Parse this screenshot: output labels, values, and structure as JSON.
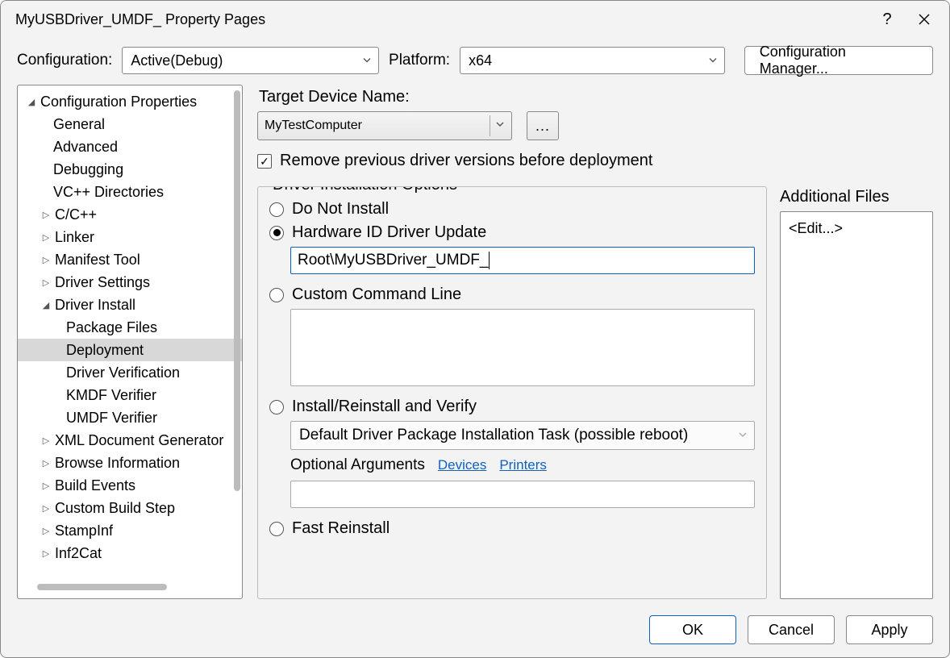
{
  "window": {
    "title": "MyUSBDriver_UMDF_ Property Pages"
  },
  "top": {
    "configuration_label": "Configuration:",
    "configuration_value": "Active(Debug)",
    "platform_label": "Platform:",
    "platform_value": "x64",
    "config_manager_label": "Configuration Manager..."
  },
  "tree": {
    "root": "Configuration Properties",
    "items": [
      {
        "label": "General",
        "level": 1
      },
      {
        "label": "Advanced",
        "level": 1
      },
      {
        "label": "Debugging",
        "level": 1
      },
      {
        "label": "VC++ Directories",
        "level": 1
      },
      {
        "label": "C/C++",
        "level": 1,
        "expander": "▷"
      },
      {
        "label": "Linker",
        "level": 1,
        "expander": "▷"
      },
      {
        "label": "Manifest Tool",
        "level": 1,
        "expander": "▷"
      },
      {
        "label": "Driver Settings",
        "level": 1,
        "expander": "▷"
      },
      {
        "label": "Driver Install",
        "level": 1,
        "expander": "◢"
      },
      {
        "label": "Package Files",
        "level": 2
      },
      {
        "label": "Deployment",
        "level": 2,
        "selected": true
      },
      {
        "label": "Driver Verification",
        "level": 2
      },
      {
        "label": "KMDF Verifier",
        "level": 2
      },
      {
        "label": "UMDF Verifier",
        "level": 2
      },
      {
        "label": "XML Document Generator",
        "level": 1,
        "expander": "▷"
      },
      {
        "label": "Browse Information",
        "level": 1,
        "expander": "▷"
      },
      {
        "label": "Build Events",
        "level": 1,
        "expander": "▷"
      },
      {
        "label": "Custom Build Step",
        "level": 1,
        "expander": "▷"
      },
      {
        "label": "StampInf",
        "level": 1,
        "expander": "▷"
      },
      {
        "label": "Inf2Cat",
        "level": 1,
        "expander": "▷"
      }
    ]
  },
  "main": {
    "target_device_label": "Target Device Name:",
    "target_device_value": "MyTestComputer",
    "ellipsis": "...",
    "remove_prev_label": "Remove previous driver versions before deployment",
    "remove_prev_checked": true,
    "fieldset_legend": "Driver Installation Options",
    "radios": {
      "do_not_install": "Do Not Install",
      "hwid": "Hardware ID Driver Update",
      "hwid_value": "Root\\MyUSBDriver_UMDF_",
      "custom_cmd": "Custom Command Line",
      "install_verify": "Install/Reinstall and Verify",
      "install_verify_value": "Default Driver Package Installation Task (possible reboot)",
      "optional_args_label": "Optional Arguments",
      "link_devices": "Devices",
      "link_printers": "Printers",
      "fast_reinstall": "Fast Reinstall"
    }
  },
  "addfiles": {
    "label": "Additional Files",
    "edit_text": "<Edit...>"
  },
  "buttons": {
    "ok": "OK",
    "cancel": "Cancel",
    "apply": "Apply"
  }
}
